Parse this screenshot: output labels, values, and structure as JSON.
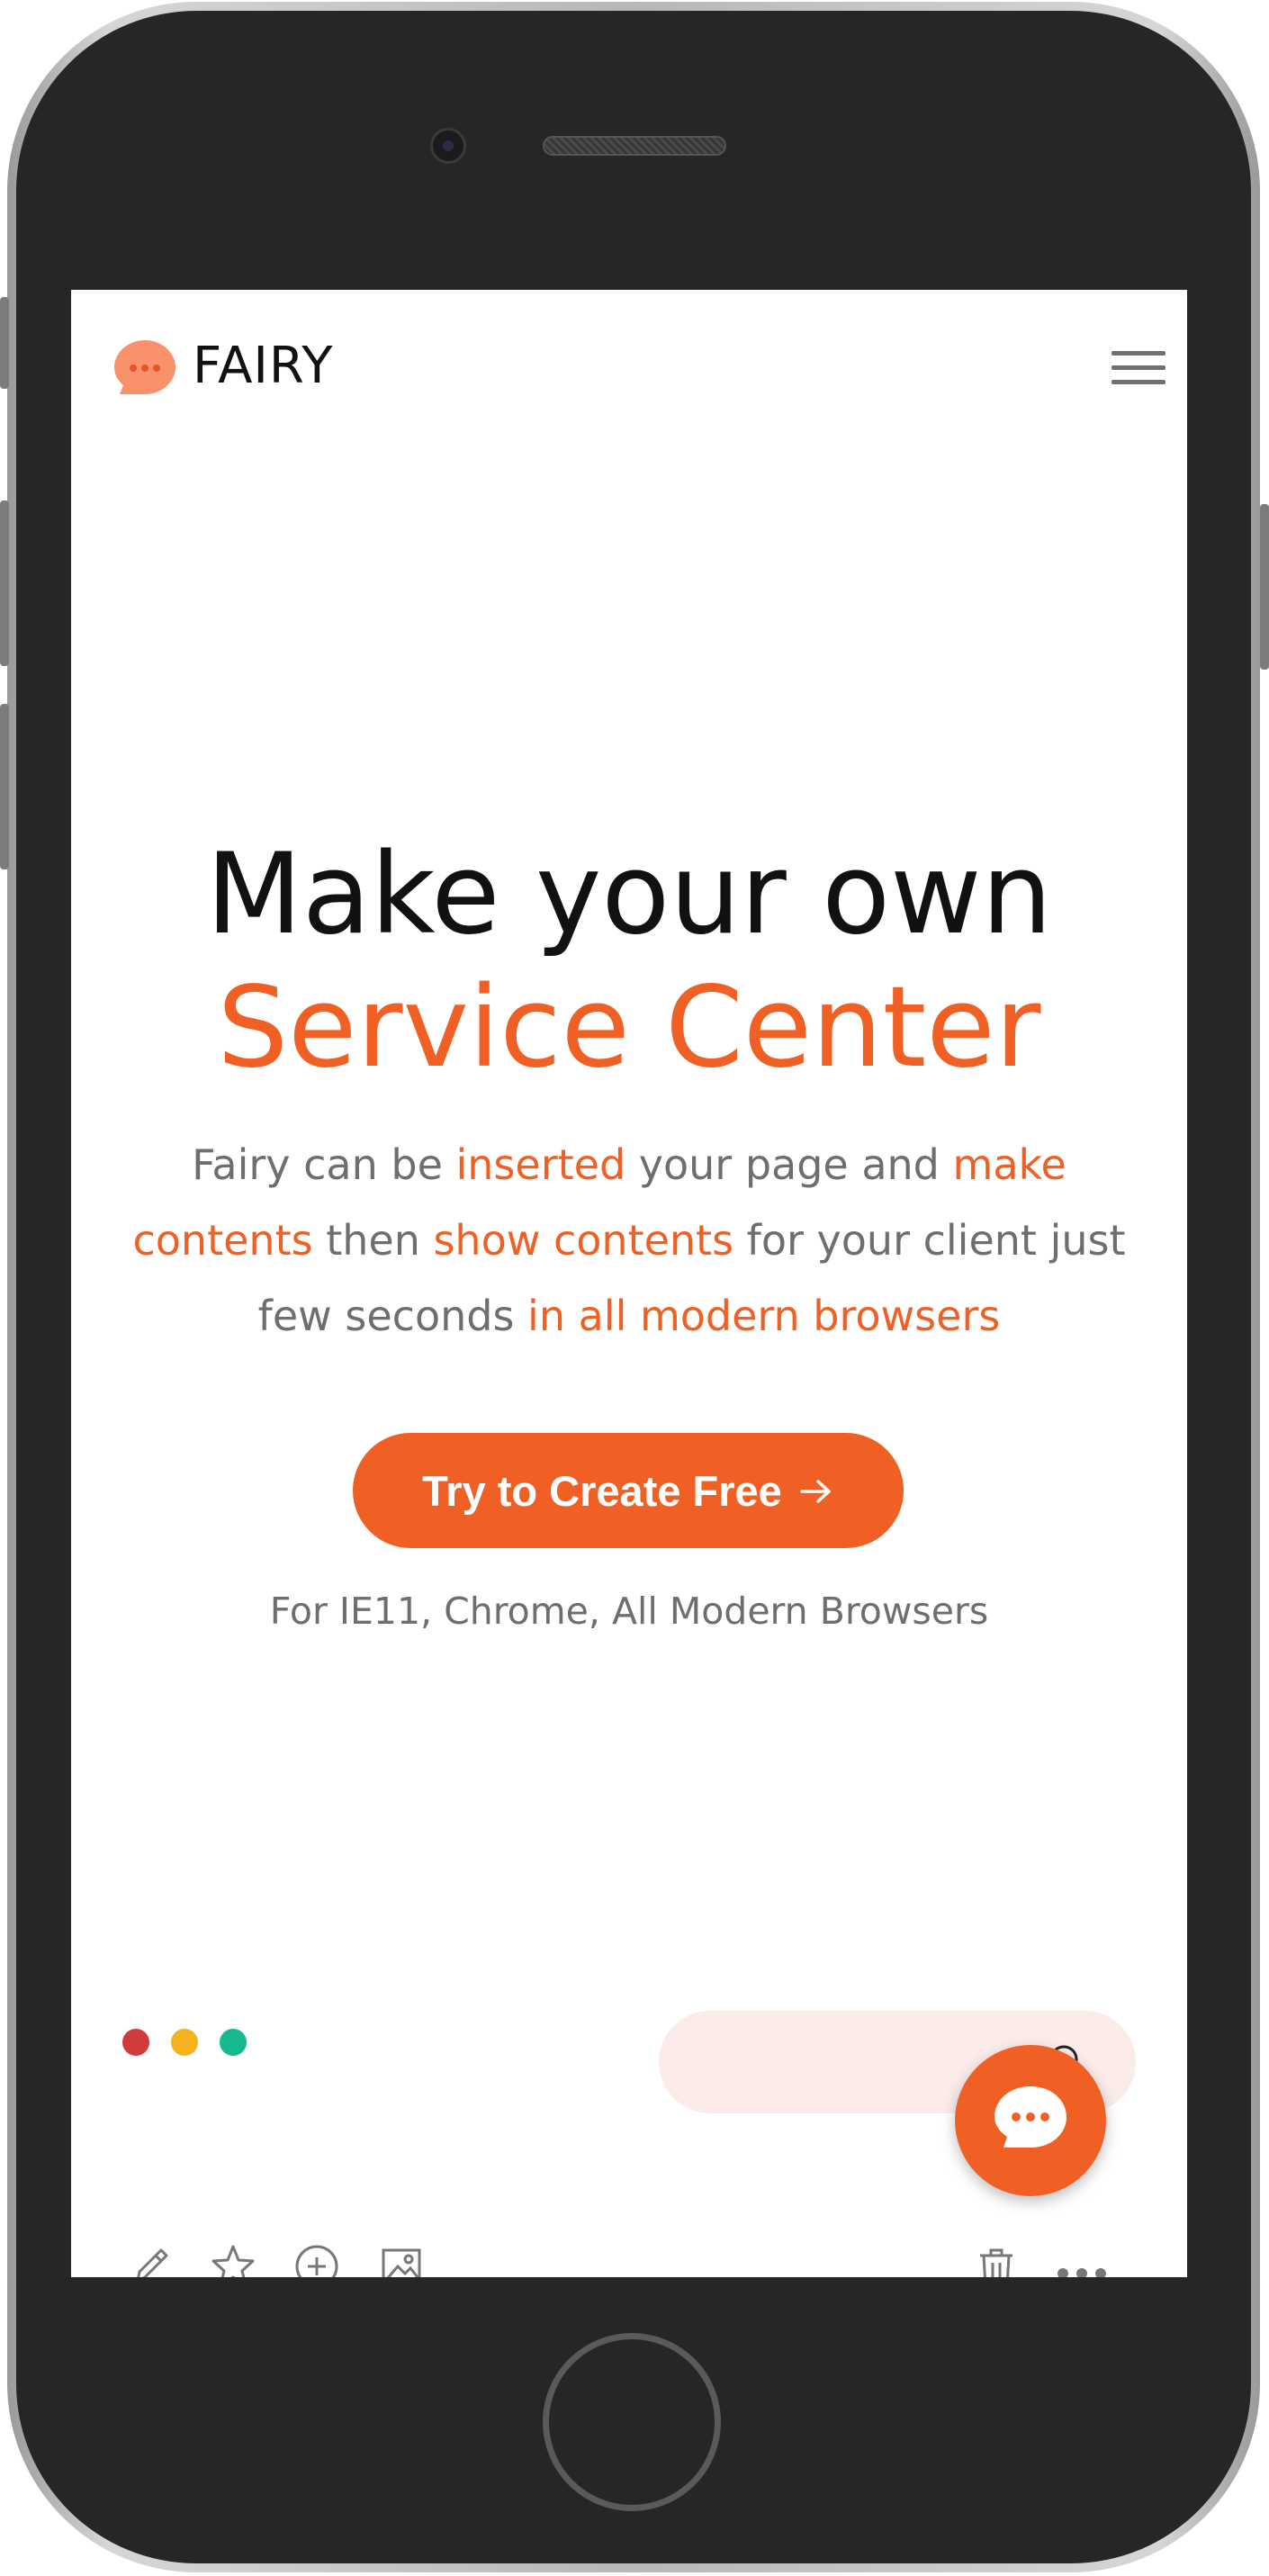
{
  "brand": {
    "name": "FAIRY",
    "accent": "#f06024",
    "logo_color": "#f9926b"
  },
  "header": {
    "menu_icon": "hamburger-menu-icon"
  },
  "hero": {
    "headline_line1": "Make your own",
    "headline_line2": "Service Center",
    "description": [
      {
        "text": "Fairy can be ",
        "highlight": false
      },
      {
        "text": "inserted",
        "highlight": true
      },
      {
        "text": " your page and ",
        "highlight": false
      },
      {
        "text": "make contents",
        "highlight": true
      },
      {
        "text": " then ",
        "highlight": false
      },
      {
        "text": "show contents",
        "highlight": true
      },
      {
        "text": " for your client just few seconds ",
        "highlight": false
      },
      {
        "text": "in all modern browsers",
        "highlight": true
      }
    ],
    "cta_label": "Try to Create Free",
    "cta_icon": "arrow-right-icon",
    "browsers_note": "For IE11, Chrome, All Modern Browsers"
  },
  "window_dots": {
    "colors": [
      "#d23b3b",
      "#f5b21e",
      "#16b98f"
    ]
  },
  "preview": {
    "search_icon": "search-icon",
    "search_bg": "#fbecea"
  },
  "toolbar": {
    "left_icons": [
      "pencil-icon",
      "star-icon",
      "plus-circle-icon",
      "image-icon"
    ],
    "right_icons": [
      "trash-icon",
      "more-icon"
    ]
  },
  "chat_fab": {
    "icon": "chat-bubble-icon"
  }
}
